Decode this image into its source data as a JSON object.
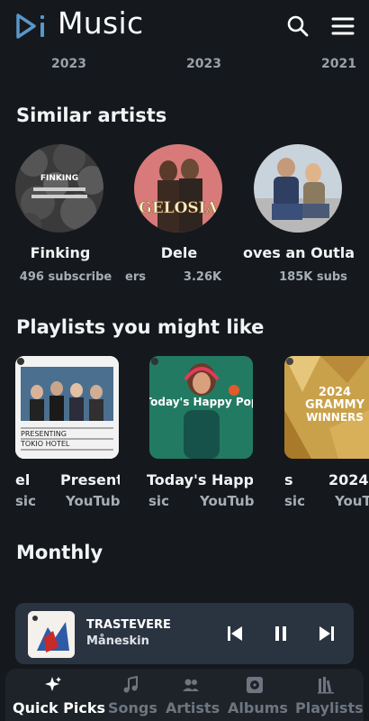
{
  "app": {
    "title": "Music"
  },
  "header": {
    "icons": [
      "logo-icon",
      "search-icon",
      "menu-icon"
    ]
  },
  "years": [
    "2023",
    "2023",
    "2021"
  ],
  "similar_artists": {
    "title": "Similar artists",
    "items": [
      {
        "name": "Finking",
        "subscribers": "496 subscribe",
        "art_text": "FINKING"
      },
      {
        "name": "Dele",
        "subscribers": "3.26K",
        "art_text": "GELOSIA"
      },
      {
        "name": "oves an Outla",
        "subscribers": "185K subs"
      }
    ],
    "partial_text": "ers"
  },
  "playlists": {
    "title": "Playlists you might like",
    "items": [
      {
        "title": "Presenti",
        "subtitle": "YouTub",
        "art_text_1": "PRESENTING",
        "art_text_2": "TOKIO HOTEL"
      },
      {
        "title": "Today's Happy I",
        "subtitle": "YouTub",
        "art_text": "Today's Happy Pop"
      },
      {
        "title": "2024",
        "subtitle": "YouT",
        "art_text_1": "2024",
        "art_text_2": "GRAMMY",
        "art_text_3": "WINNERS"
      }
    ],
    "left_partials": {
      "title": "el",
      "subtitle": "sic"
    },
    "between_partials": {
      "title": "s",
      "subtitle": "sic"
    },
    "subtitle_fragment": "sic"
  },
  "monthly": {
    "title": "Monthly"
  },
  "now_playing": {
    "title": "TRASTEVERE",
    "artist": "Måneskin",
    "icons": [
      "previous-icon",
      "pause-icon",
      "next-icon"
    ]
  },
  "bottom_nav": {
    "items": [
      {
        "label": "Quick Picks",
        "icon": "sparkle-icon",
        "active": true
      },
      {
        "label": "Songs",
        "icon": "music-note-icon"
      },
      {
        "label": "Artists",
        "icon": "people-icon"
      },
      {
        "label": "Albums",
        "icon": "disc-icon"
      },
      {
        "label": "Playlists",
        "icon": "library-icon"
      }
    ]
  },
  "colors": {
    "background": "#15191d",
    "accent": "#5a96c8",
    "player_bg": "#2a3440",
    "nav_bg": "#1d2329"
  }
}
